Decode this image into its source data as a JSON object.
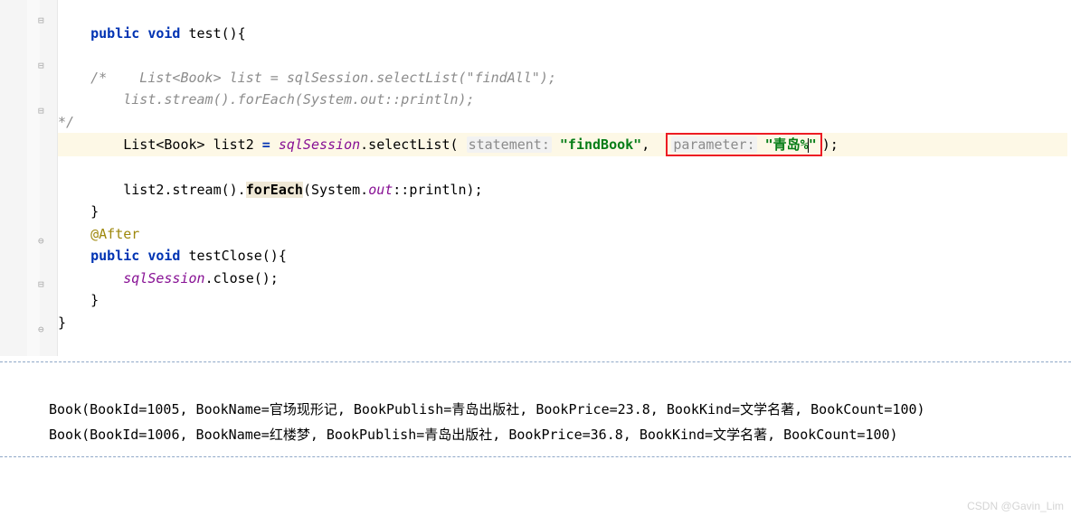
{
  "code": {
    "l1_kw1": "public",
    "l1_kw2": "void",
    "l1_name": " test(){",
    "l3_cm": "/*    List<Book> list = sqlSession.selectList(\"findAll\");",
    "l4_cm": "        list.stream().forEach(System.out::println);",
    "l5_cm": "*/",
    "l6_p1": "        List<Book> list2 ",
    "l6_op": "=",
    "l6_p2": " ",
    "l6_fld": "sqlSession",
    "l6_p3": ".selectList( ",
    "l6_hint1": "statement:",
    "l6_p4": " ",
    "l6_str1": "\"findBook\"",
    "l6_p5": ",  ",
    "l6_hint2": "parameter:",
    "l6_p6": " ",
    "l6_str2": "\"青岛%",
    "l6_str2b": "\"",
    "l6_p7": ");",
    "l8_p1": "        list2.stream().",
    "l8_fe": "forEach",
    "l8_p2": "(System.",
    "l8_out": "out",
    "l8_p3": "::println);",
    "l9": "    }",
    "l10_anno": "@After",
    "l11_kw1": "public",
    "l11_kw2": "void",
    "l11_name": " testClose(){",
    "l12_fld": "sqlSession",
    "l12_p1": ".close();",
    "l13": "    }",
    "l14": "}"
  },
  "output": {
    "row1": "Book(BookId=1005, BookName=官场现形记, BookPublish=青岛出版社, BookPrice=23.8, BookKind=文学名著, BookCount=100)",
    "row2": "Book(BookId=1006, BookName=红楼梦, BookPublish=青岛出版社, BookPrice=36.8, BookKind=文学名著, BookCount=100)"
  },
  "watermark": "CSDN @Gavin_Lim"
}
